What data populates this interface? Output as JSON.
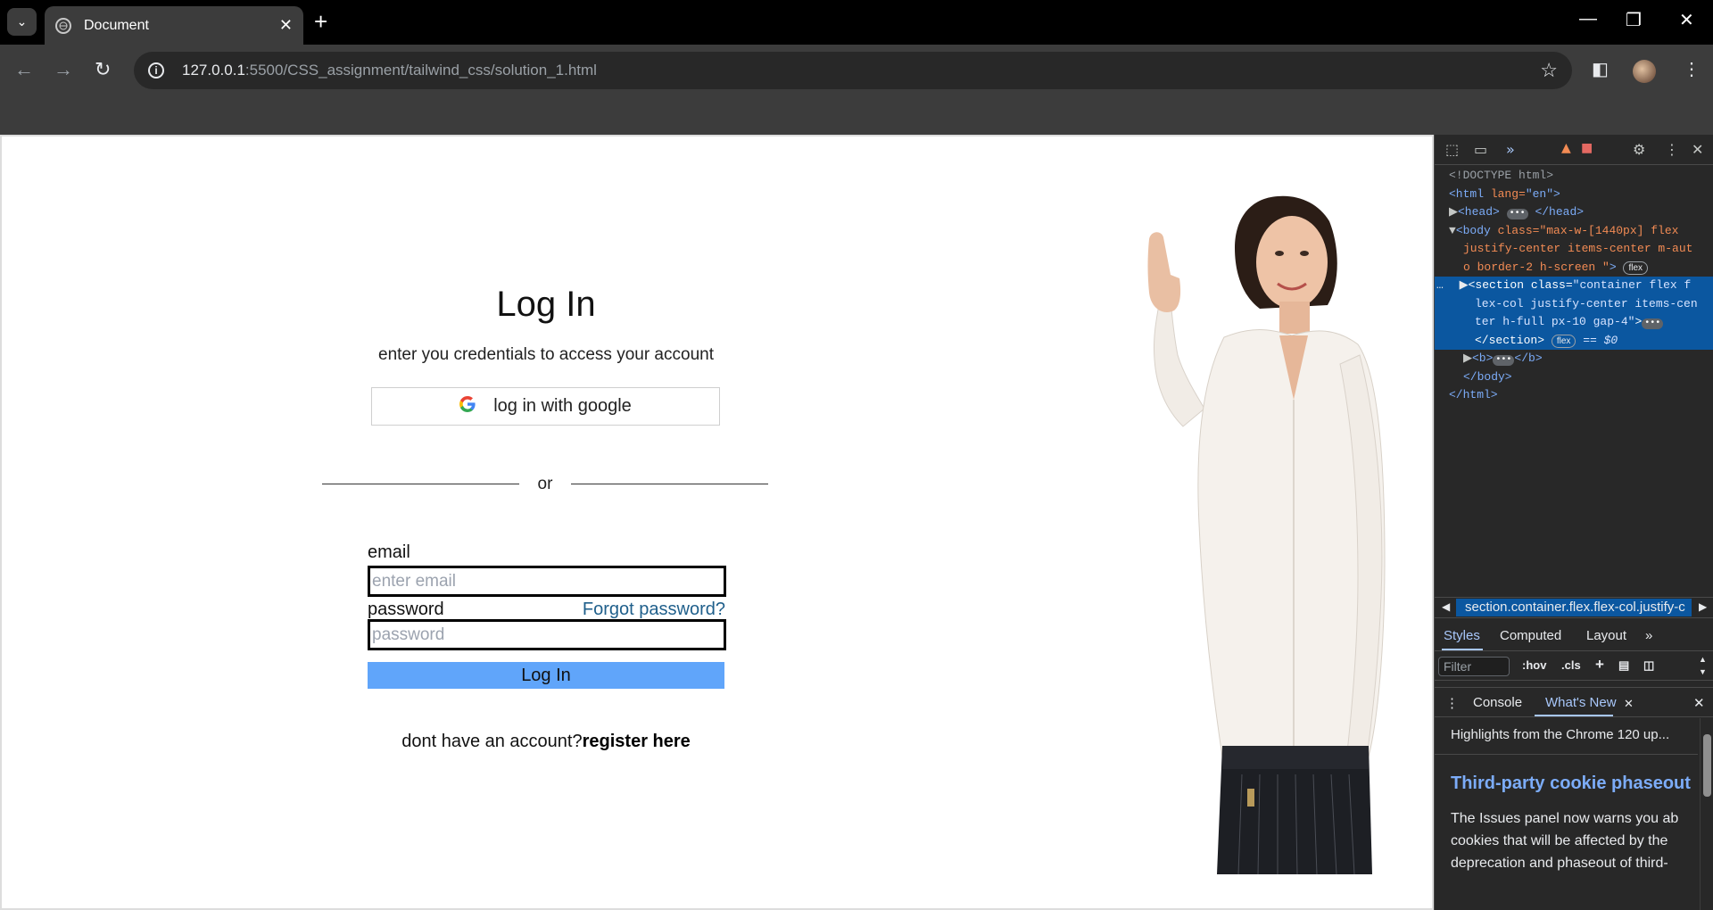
{
  "browser": {
    "tab_title": "Document",
    "url_host": "127.0.0.1",
    "url_rest": ":5500/CSS_assignment/tailwind_css/solution_1.html"
  },
  "login": {
    "title": "Log In",
    "subtitle": "enter you credentials to access your account",
    "google_button": "log in with google",
    "divider_text": "or",
    "email_label": "email",
    "email_placeholder": "enter email",
    "password_label": "password",
    "password_placeholder": "password",
    "forgot_link": "Forgot password?",
    "submit_button": "Log In",
    "register_prompt": "dont have an account?",
    "register_link": "register here"
  },
  "devtools": {
    "dom": {
      "doctype": "<!DOCTYPE html>",
      "html_open": "<html",
      "html_attr": " lang=",
      "html_val": "\"en\"",
      "html_close": ">",
      "head": "<head>",
      "head_end": "</head>",
      "body_open": "<body",
      "body_attr": " class=",
      "body_val1": "\"max-w-[1440px] flex",
      "body_val2": "justify-center items-center m-aut",
      "body_val3": "o border-2 h-screen \"",
      "body_close": ">",
      "section_open": "<section",
      "section_attr": " class=",
      "section_val1": "\"container flex f",
      "section_val2": "lex-col justify-center items-cen",
      "section_val3": "ter h-full px-10 gap-4\"",
      "section_end": "</section>",
      "selected_marker": "== $0",
      "b_open": "<b>",
      "b_end": "</b>",
      "body_end": "</body>",
      "html_end": "</html>",
      "flex_badge": "flex",
      "dots": "•••",
      "ellipsis": "…"
    },
    "breadcrumb": "section.container.flex.flex-col.justify-c",
    "styles_tabs": [
      "Styles",
      "Computed",
      "Layout"
    ],
    "filter_placeholder": "Filter",
    "hov": ":hov",
    "cls": ".cls",
    "drawer_tabs": [
      "Console",
      "What's New"
    ],
    "whats_new": {
      "highlight": "Highlights from the Chrome 120 up...",
      "heading": "Third-party cookie phaseout",
      "body_lines": [
        "The Issues panel now warns you ab",
        "cookies that will be affected by the",
        "deprecation and phaseout of third-"
      ]
    }
  },
  "colors": {
    "submit_button_bg": "#60a5fa",
    "forgot_link": "#1f5f8b",
    "devtools_bg": "#282828",
    "selected_row": "#0b57a0"
  }
}
